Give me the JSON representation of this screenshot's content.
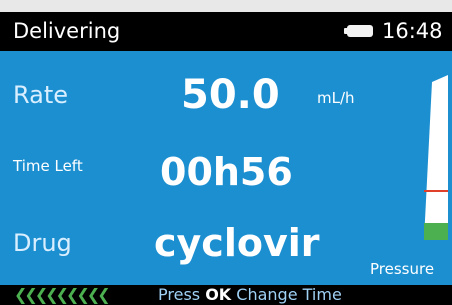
{
  "status_bar": {
    "title": "Delivering",
    "time": "16:48",
    "battery_icon": "battery-icon"
  },
  "infusion": {
    "rate": {
      "label": "Rate",
      "value": "50.0",
      "unit": "mL/h"
    },
    "time_left": {
      "label": "Time Left",
      "value": "00h56"
    },
    "drug": {
      "label": "Drug",
      "value": "cyclovir"
    }
  },
  "pressure": {
    "label": "Pressure",
    "level": 0.1,
    "limit": 0.3
  },
  "footer": {
    "chevrons": "❮❮❮❮❮❮❮❮❮",
    "hint_prefix": "Press ",
    "hint_key": "OK",
    "hint_suffix": " Change Time"
  },
  "colors": {
    "background": "#1c8fd1",
    "bar": "#000000",
    "accent_green": "#4caf50",
    "pressure_line": "#e0402a"
  }
}
